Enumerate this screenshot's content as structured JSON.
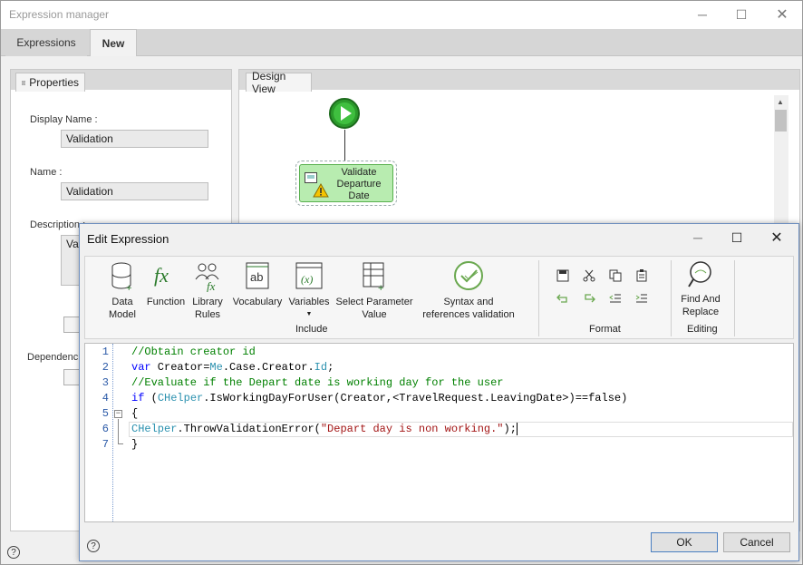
{
  "outer_window": {
    "title": "Expression manager",
    "tabs": [
      {
        "label": "Expressions"
      },
      {
        "label": "New"
      }
    ]
  },
  "properties": {
    "tab_label": "Properties",
    "display_name_label": "Display Name :",
    "display_name_value": "Validation",
    "name_label": "Name :",
    "name_value": "Validation",
    "description_label": "Description :",
    "description_value": "Vali",
    "dependencies_label": "Dependenc"
  },
  "design_view": {
    "tab_label": "Design View",
    "activity_label": "Validate Departure Date"
  },
  "dialog": {
    "title": "Edit Expression",
    "ribbon": {
      "include_group": "Include",
      "format_group": "Format",
      "editing_group": "Editing",
      "buttons": {
        "data_model": "Data Model",
        "function": "Function",
        "library_rules": "Library Rules",
        "vocabulary": "Vocabulary",
        "variables": "Variables",
        "select_parameter_value": "Select Parameter Value",
        "syntax_validation": "Syntax and references validation",
        "find_and_replace": "Find And Replace"
      }
    },
    "code_lines": [
      "1",
      "2",
      "3",
      "4",
      "5",
      "6",
      "7"
    ],
    "code": {
      "l1": "//Obtain creator id",
      "l2_kw": "var",
      "l2_a": " Creator=",
      "l2_me": "Me",
      "l2_b": ".Case.Creator.",
      "l2_id": "Id",
      "l2_c": ";",
      "l3": "//Evaluate if the Depart date is working day for the user",
      "l4_kw": "if",
      "l4_a": " (",
      "l4_ty": "CHelper",
      "l4_b": ".IsWorkingDayForUser(Creator,<TravelRequest.LeavingDate>)==false)",
      "l5": "{",
      "l6_ty": "CHelper",
      "l6_a": ".ThrowValidationError(",
      "l6_str": "\"Depart day is non working.\"",
      "l6_b": ");",
      "l7": "}"
    },
    "ok_label": "OK",
    "cancel_label": "Cancel"
  }
}
